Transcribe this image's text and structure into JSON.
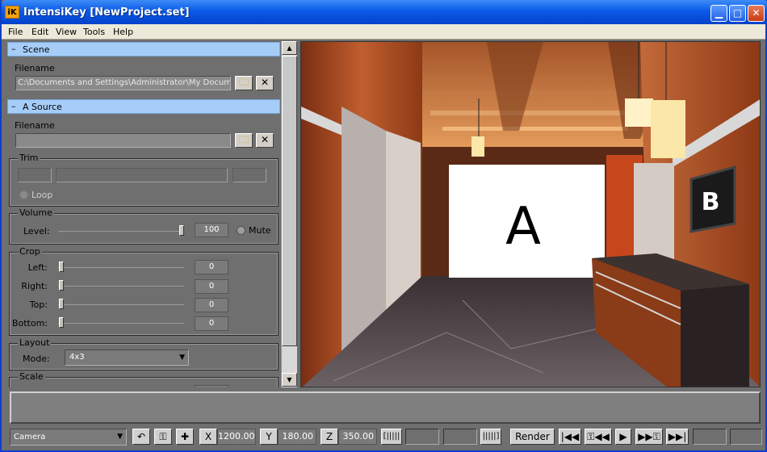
{
  "window": {
    "logo": "iK",
    "title": "IntensiKey [NewProject.set]",
    "controls": [
      "minimize-icon",
      "maximize-icon",
      "close-icon"
    ]
  },
  "menu": [
    "File",
    "Edit",
    "View",
    "Tools",
    "Help"
  ],
  "panel": {
    "scene": {
      "collapse": "–",
      "title": "Scene",
      "filename_label": "Filename",
      "filename_value": "C:\\Documents and Settings\\Administrator\\My Docume"
    },
    "source": {
      "collapse": "–",
      "title": "A Source",
      "filename_label": "Filename",
      "filename_value": "",
      "trim": {
        "title": "Trim",
        "loop_label": "Loop"
      },
      "volume": {
        "title": "Volume",
        "level_label": "Level:",
        "level_value": "100",
        "level_fraction": 1.0,
        "mute_label": "Mute"
      },
      "crop": {
        "title": "Crop",
        "rows": [
          {
            "label": "Left:",
            "value": "0"
          },
          {
            "label": "Right:",
            "value": "0"
          },
          {
            "label": "Top:",
            "value": "0"
          },
          {
            "label": "Bottom:",
            "value": "0"
          }
        ]
      },
      "layout": {
        "title": "Layout",
        "mode_label": "Mode:",
        "mode_value": "4x3"
      },
      "scale": {
        "title": "Scale"
      }
    }
  },
  "viewport": {
    "screen_letter": "A",
    "sign_letter": "B"
  },
  "toolbar": {
    "camera_value": "Camera",
    "x_label": "X",
    "x_value": "1200.00",
    "y_label": "Y",
    "y_value": "180.00",
    "z_label": "Z",
    "z_value": "350.00",
    "render_label": "Render"
  },
  "colors": {
    "titlebar": "#0a5ae8",
    "section_header": "#a6cdf8",
    "panel_bg": "#6f6f6f",
    "wall_wood": "#b0552a"
  }
}
